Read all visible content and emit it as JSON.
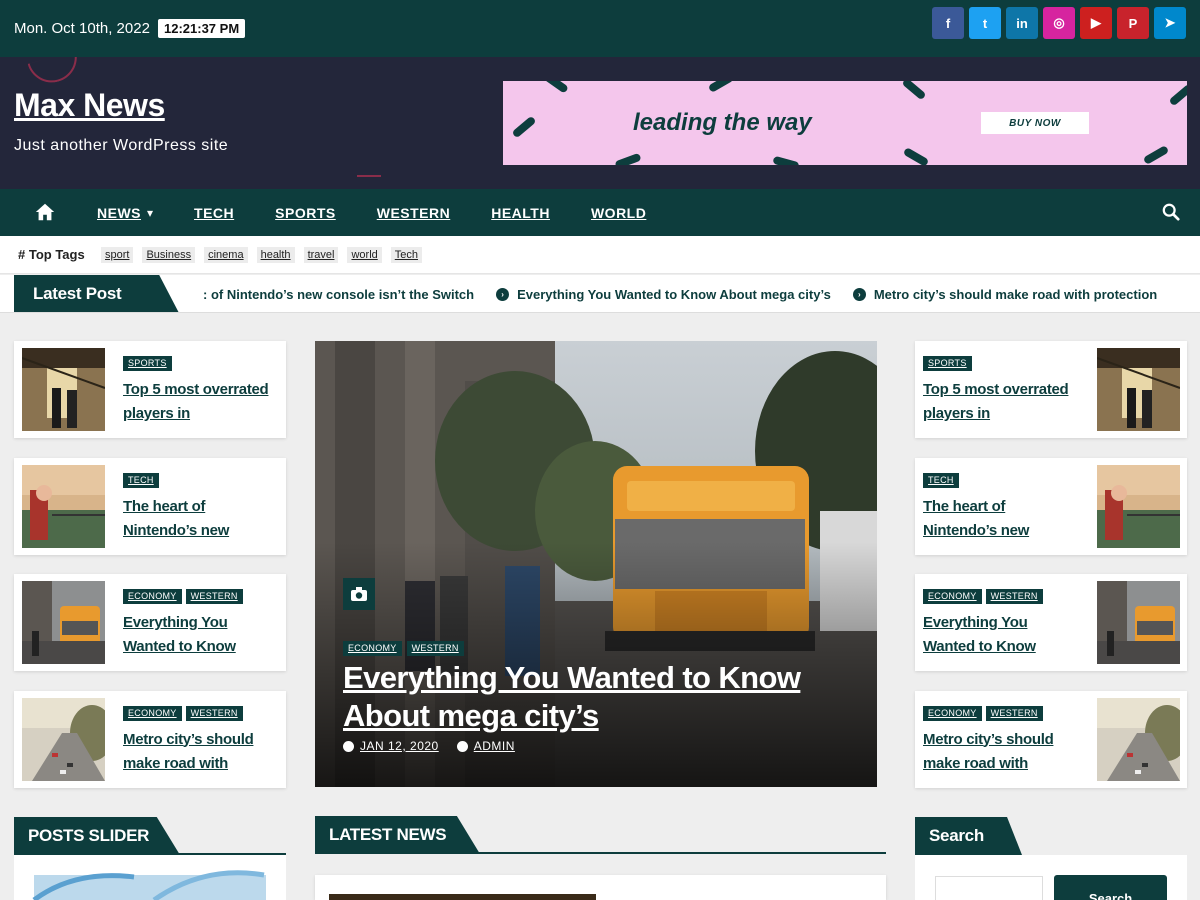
{
  "topbar": {
    "date": "Mon. Oct 10th, 2022",
    "time": "12:21:37 PM",
    "socials": [
      {
        "name": "facebook-icon",
        "glyph": "f",
        "color": "#3b5998"
      },
      {
        "name": "twitter-icon",
        "glyph": "t",
        "color": "#1da1f2"
      },
      {
        "name": "linkedin-icon",
        "glyph": "in",
        "color": "#0e76a8"
      },
      {
        "name": "instagram-icon",
        "glyph": "◎",
        "color": "#d6249f"
      },
      {
        "name": "youtube-icon",
        "glyph": "▶",
        "color": "#cd201f"
      },
      {
        "name": "pinterest-icon",
        "glyph": "P",
        "color": "#c8232c"
      },
      {
        "name": "telegram-icon",
        "glyph": "➤",
        "color": "#0088cc"
      }
    ]
  },
  "header": {
    "site_title": "Max News",
    "site_description": "Just another WordPress site",
    "banner": {
      "tagline": "leading the way",
      "button": "BUY NOW"
    }
  },
  "nav": {
    "items": [
      "NEWS",
      "TECH",
      "SPORTS",
      "WESTERN",
      "HEALTH",
      "WORLD"
    ]
  },
  "tags": {
    "title": "Top Tags",
    "items": [
      "sport",
      "Business",
      "cinema",
      "health",
      "travel",
      "world",
      "Tech"
    ]
  },
  "ticker": {
    "label": "Latest Post",
    "items": [
      ": of Nintendo’s new console isn’t the Switch",
      "Everything You Wanted to Know About mega city’s",
      "Metro city’s should make road with protection"
    ]
  },
  "side_posts": [
    {
      "cats": [
        "SPORTS"
      ],
      "title": "Top 5 most overrated players in"
    },
    {
      "cats": [
        "TECH"
      ],
      "title": "The heart of Nintendo’s new"
    },
    {
      "cats": [
        "ECONOMY",
        "WESTERN"
      ],
      "title": "Everything You Wanted to Know"
    },
    {
      "cats": [
        "ECONOMY",
        "WESTERN"
      ],
      "title": "Metro city’s should make road with"
    }
  ],
  "hero": {
    "cats": [
      "ECONOMY",
      "WESTERN"
    ],
    "title": "Everything You Wanted to Know About mega city’s",
    "date": "JAN 12, 2020",
    "author": "ADMIN"
  },
  "widgets": {
    "posts_slider": "POSTS SLIDER",
    "latest_news": "LATEST NEWS",
    "search": "Search",
    "search_button": "Search"
  },
  "colors": {
    "primary": "#0d3d3d",
    "header_bg": "#23263a",
    "banner_bg": "#f4c6ec"
  }
}
